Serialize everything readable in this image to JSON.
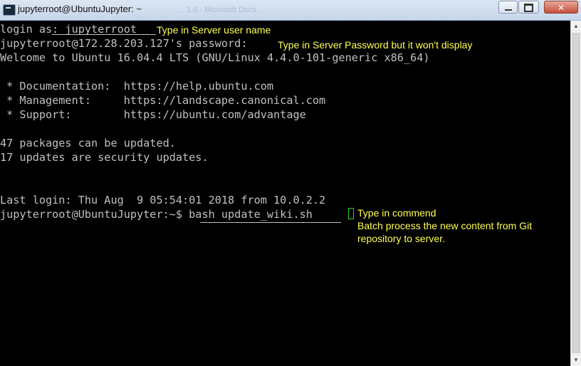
{
  "window": {
    "title": "jupyterroot@UbuntuJupyter: ~",
    "background_tab": "... 1.0 - Microsoft Docs ...",
    "buttons": {
      "minimize": "",
      "maximize": "",
      "close": "✕"
    }
  },
  "terminal": {
    "lines": [
      "login as: jupyterroot",
      "jupyterroot@172.28.203.127's password:",
      "Welcome to Ubuntu 16.04.4 LTS (GNU/Linux 4.4.0-101-generic x86_64)",
      "",
      " * Documentation:  https://help.ubuntu.com",
      " * Management:     https://landscape.canonical.com",
      " * Support:        https://ubuntu.com/advantage",
      "",
      "47 packages can be updated.",
      "17 updates are security updates.",
      "",
      "",
      "Last login: Thu Aug  9 05:54:01 2018 from 10.0.2.2",
      "jupyterroot@UbuntuJupyter:~$ bash update_wiki.sh"
    ]
  },
  "annotations": {
    "username": "Type in Server  user name",
    "password": "Type in Server Password  but it won't display",
    "command_line1": "Type in commend",
    "command_line2": "Batch process the  new content  from Git",
    "command_line3": "repository to server."
  },
  "colors": {
    "terminal_bg": "#000000",
    "terminal_fg": "#c0c0c0",
    "annotation": "#ffff55",
    "cursor": "#27d827"
  }
}
